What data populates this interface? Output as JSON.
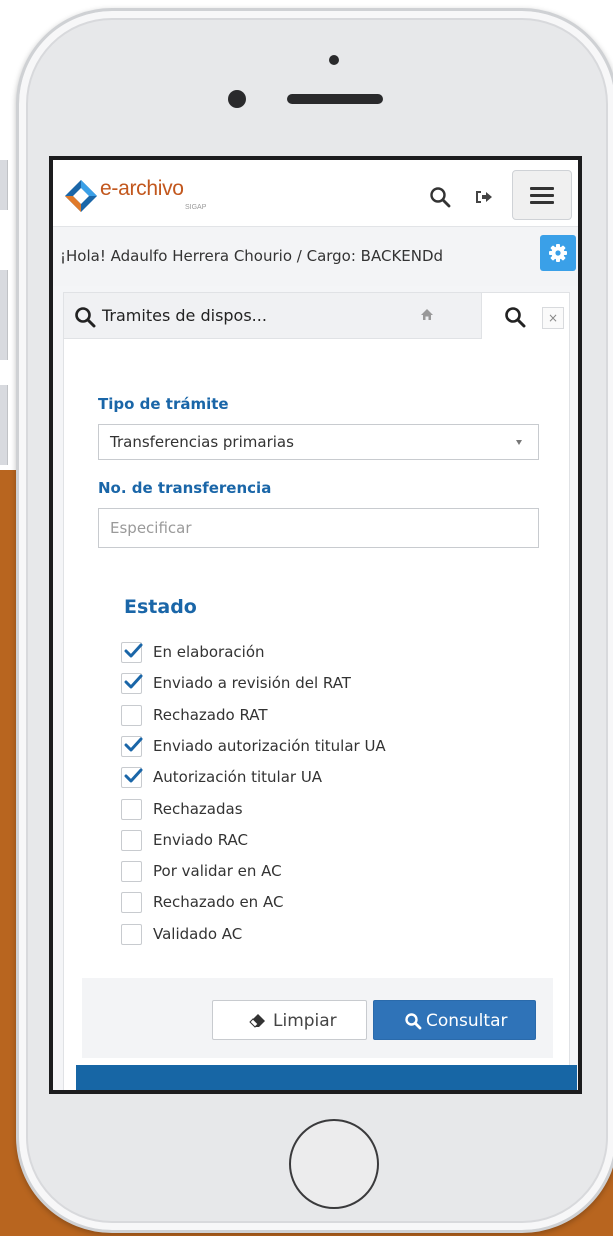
{
  "colors": {
    "accent_blue": "#1a66a8",
    "button_blue": "#2f73b8",
    "gear_blue": "#3aa0e8",
    "logo_orange": "#c2571d",
    "background_orange": "#b8651f"
  },
  "header": {
    "logo_text": "e-archivo",
    "logo_subtext": "SIGAP",
    "logo_icon": "diamond-logo-icon",
    "search_icon": "search-icon",
    "logout_icon": "sign-out-icon",
    "menu_icon": "hamburger-menu-icon"
  },
  "greeting": {
    "text": "¡Hola! Adaulfo Herrera Chourio / Cargo: BACKENDd",
    "settings_icon": "gear-icon"
  },
  "tabs": {
    "main_title": "Tramites de dispos...",
    "main_icon": "search-icon",
    "home_icon": "home-icon",
    "active_icon": "search-icon",
    "close_label": "×"
  },
  "form": {
    "tipo_label": "Tipo de trámite",
    "tipo_value": "Transferencias primarias",
    "no_label": "No. de transferencia",
    "no_value": "",
    "no_placeholder": "Especificar"
  },
  "estado": {
    "title": "Estado",
    "options": [
      {
        "label": "En elaboración",
        "checked": true
      },
      {
        "label": "Enviado a revisión del RAT",
        "checked": true
      },
      {
        "label": "Rechazado RAT",
        "checked": false
      },
      {
        "label": "Enviado autorización titular UA",
        "checked": true
      },
      {
        "label": "Autorización titular UA",
        "checked": true
      },
      {
        "label": "Rechazadas",
        "checked": false
      },
      {
        "label": "Enviado RAC",
        "checked": false
      },
      {
        "label": "Por validar en AC",
        "checked": false
      },
      {
        "label": "Rechazado en AC",
        "checked": false
      },
      {
        "label": "Validado AC",
        "checked": false
      }
    ]
  },
  "actions": {
    "limpiar_label": "Limpiar",
    "limpiar_icon": "eraser-icon",
    "consultar_label": "Consultar",
    "consultar_icon": "search-icon"
  }
}
